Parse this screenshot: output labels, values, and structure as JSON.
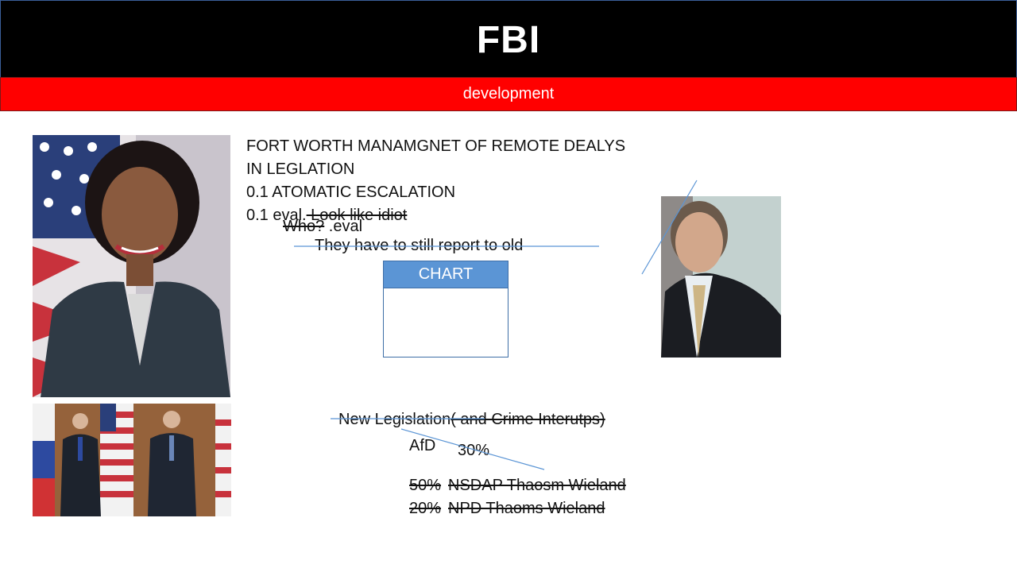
{
  "slide": {
    "title": "FBI",
    "subtitle": "development"
  },
  "notes": {
    "line1": "FORT WORTH MANAMGNET OF REMOTE DEALYS",
    "line2": "IN LEGLATION",
    "line3": "0.1 ATOMATIC ESCALATION",
    "line4_prefix": "0.1 eval.",
    "line4_struck": " Look like idiot",
    "who_struck": "Who?",
    "who_suffix": " .eval",
    "report_line": "They have to still report to old"
  },
  "chart_box": {
    "header": "CHART"
  },
  "legislation": {
    "heading": "New Legislation",
    "heading_struck": "( and Crime Interutps)",
    "party_label": "AfD",
    "party_value": "30%",
    "rows": [
      {
        "pct": "50%",
        "label": "NSDAP Thaosm Wieland"
      },
      {
        "pct": "20%",
        "label": "NPD Thaoms Wieland"
      }
    ]
  },
  "colors": {
    "title_bg": "#000000",
    "subtitle_bg": "#ff0000",
    "chart_header": "#5b95d5",
    "annotation_line": "#5b95d5"
  }
}
